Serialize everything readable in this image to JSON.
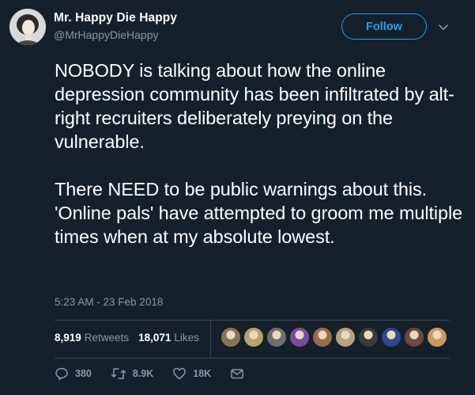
{
  "user": {
    "display_name": "Mr. Happy Die Happy",
    "handle": "@MrHappyDieHappy"
  },
  "follow_button": {
    "label": "Follow"
  },
  "tweet": {
    "paragraphs": [
      "NOBODY is talking about how the online depression community has been infiltrated by alt-right recruiters deliberately preying on the vulnerable.",
      "There NEED to be public warnings about this. 'Online pals' have attempted to groom me multiple times when at my absolute lowest."
    ],
    "timestamp": "5:23 AM - 23 Feb 2018"
  },
  "stats": {
    "retweets_count": "8,919",
    "retweets_label": "Retweets",
    "likes_count": "18,071",
    "likes_label": "Likes"
  },
  "likers": {
    "count": 10,
    "colors": [
      "#8a7355",
      "#b9a36a",
      "#6e6e6e",
      "#7a4aa0",
      "#9b6b4a",
      "#b8a37c",
      "#3b3b3b",
      "#2c4a8a",
      "#6d4a3b",
      "#c99a5a"
    ]
  },
  "actions": {
    "replies": "380",
    "retweets": "8.9K",
    "likes": "18K"
  },
  "icons": [
    "caret-down-icon",
    "reply-icon",
    "retweet-icon",
    "heart-icon",
    "message-icon"
  ],
  "colors": {
    "background": "#15202b",
    "accent": "#1da1f2",
    "muted": "#8899a6",
    "divider": "#38444d"
  }
}
